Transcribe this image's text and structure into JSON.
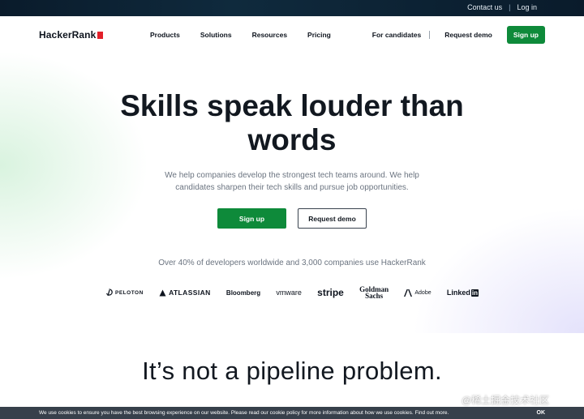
{
  "topbar": {
    "contact": "Contact us",
    "login": "Log in",
    "sep": "|"
  },
  "nav": {
    "logo": "HackerRank",
    "menu": [
      "Products",
      "Solutions",
      "Resources",
      "Pricing"
    ],
    "for_candidates": "For candidates",
    "request_demo": "Request demo",
    "sign_up": "Sign up"
  },
  "hero": {
    "headline_line1": "Skills speak louder than",
    "headline_line2": "words",
    "sub_line1": "We help companies develop the strongest tech teams around. We help",
    "sub_line2": "candidates sharpen their tech skills and pursue job opportunities.",
    "signup_button": "Sign up",
    "demo_button": "Request demo",
    "stat": "Over 40% of developers worldwide and 3,000 companies use HackerRank"
  },
  "logos": {
    "peloton": "PELOTON",
    "atlassian": "ATLASSIAN",
    "bloomberg": "Bloomberg",
    "vmware": "vmware",
    "stripe": "stripe",
    "goldman_line1": "Goldman",
    "goldman_line2": "Sachs",
    "adobe": "Adobe",
    "linkedin_text": "Linked",
    "linkedin_in": "in"
  },
  "section2": {
    "title": "It’s not a pipeline problem."
  },
  "watermark": "@稀土掘金技术社区",
  "cookie": {
    "message": "We use cookies to ensure you have the best browsing experience on our website. Please read our cookie policy for more information about how we use cookies. Find out more.",
    "ok": "OK"
  },
  "colors": {
    "brand_green": "#0e8a3a",
    "logo_red": "#e2202a",
    "topbar_bg": "#0a1b2b"
  }
}
